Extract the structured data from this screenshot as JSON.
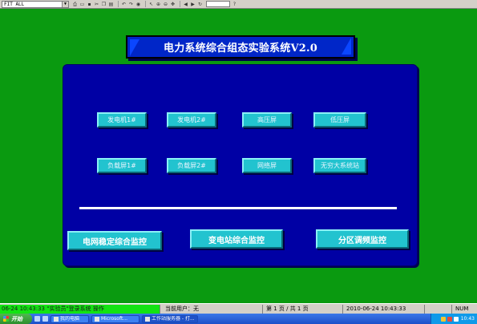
{
  "toolbar": {
    "zoom_value": "FIT ALL",
    "icons": [
      "print-icon",
      "open-icon",
      "save-icon",
      "cut-icon",
      "copy-icon",
      "paste-icon",
      "undo-icon",
      "redo-icon",
      "alarm-icon",
      "select-icon",
      "zoom-in-icon",
      "zoom-out-icon",
      "pan-icon",
      "back-icon",
      "forward-icon",
      "refresh-icon",
      "help-icon"
    ]
  },
  "title": "电力系统综合组态实验系统V2.0",
  "panel": {
    "row1": [
      "发电机1#",
      "发电机2#",
      "高压屏",
      "低压屏"
    ],
    "row2": [
      "负载屏1#",
      "负载屏2#",
      "网络屏",
      "无穷大系统站"
    ],
    "big_buttons": [
      "电网稳定综合监控",
      "变电站综合监控",
      "分区调频监控"
    ]
  },
  "statusbar": {
    "alarm": "06-24  10:43:33   \"实验员\"登录系统  操作",
    "user": "当前用户：无",
    "page": "第 1 页 / 共 1 页",
    "datetime": "2010-06-24  10:43:33",
    "extra": "",
    "num": "NUM"
  },
  "taskbar": {
    "start_label": "开始",
    "tasks": [
      "我的电脑",
      "Microsoft...",
      "工作站服务器 - 打..."
    ],
    "clock": "10:43"
  },
  "colors": {
    "background": "#0a9a10",
    "panel": "#0000a4",
    "button": "#22c3cf",
    "title_bg": "#0026c8"
  }
}
